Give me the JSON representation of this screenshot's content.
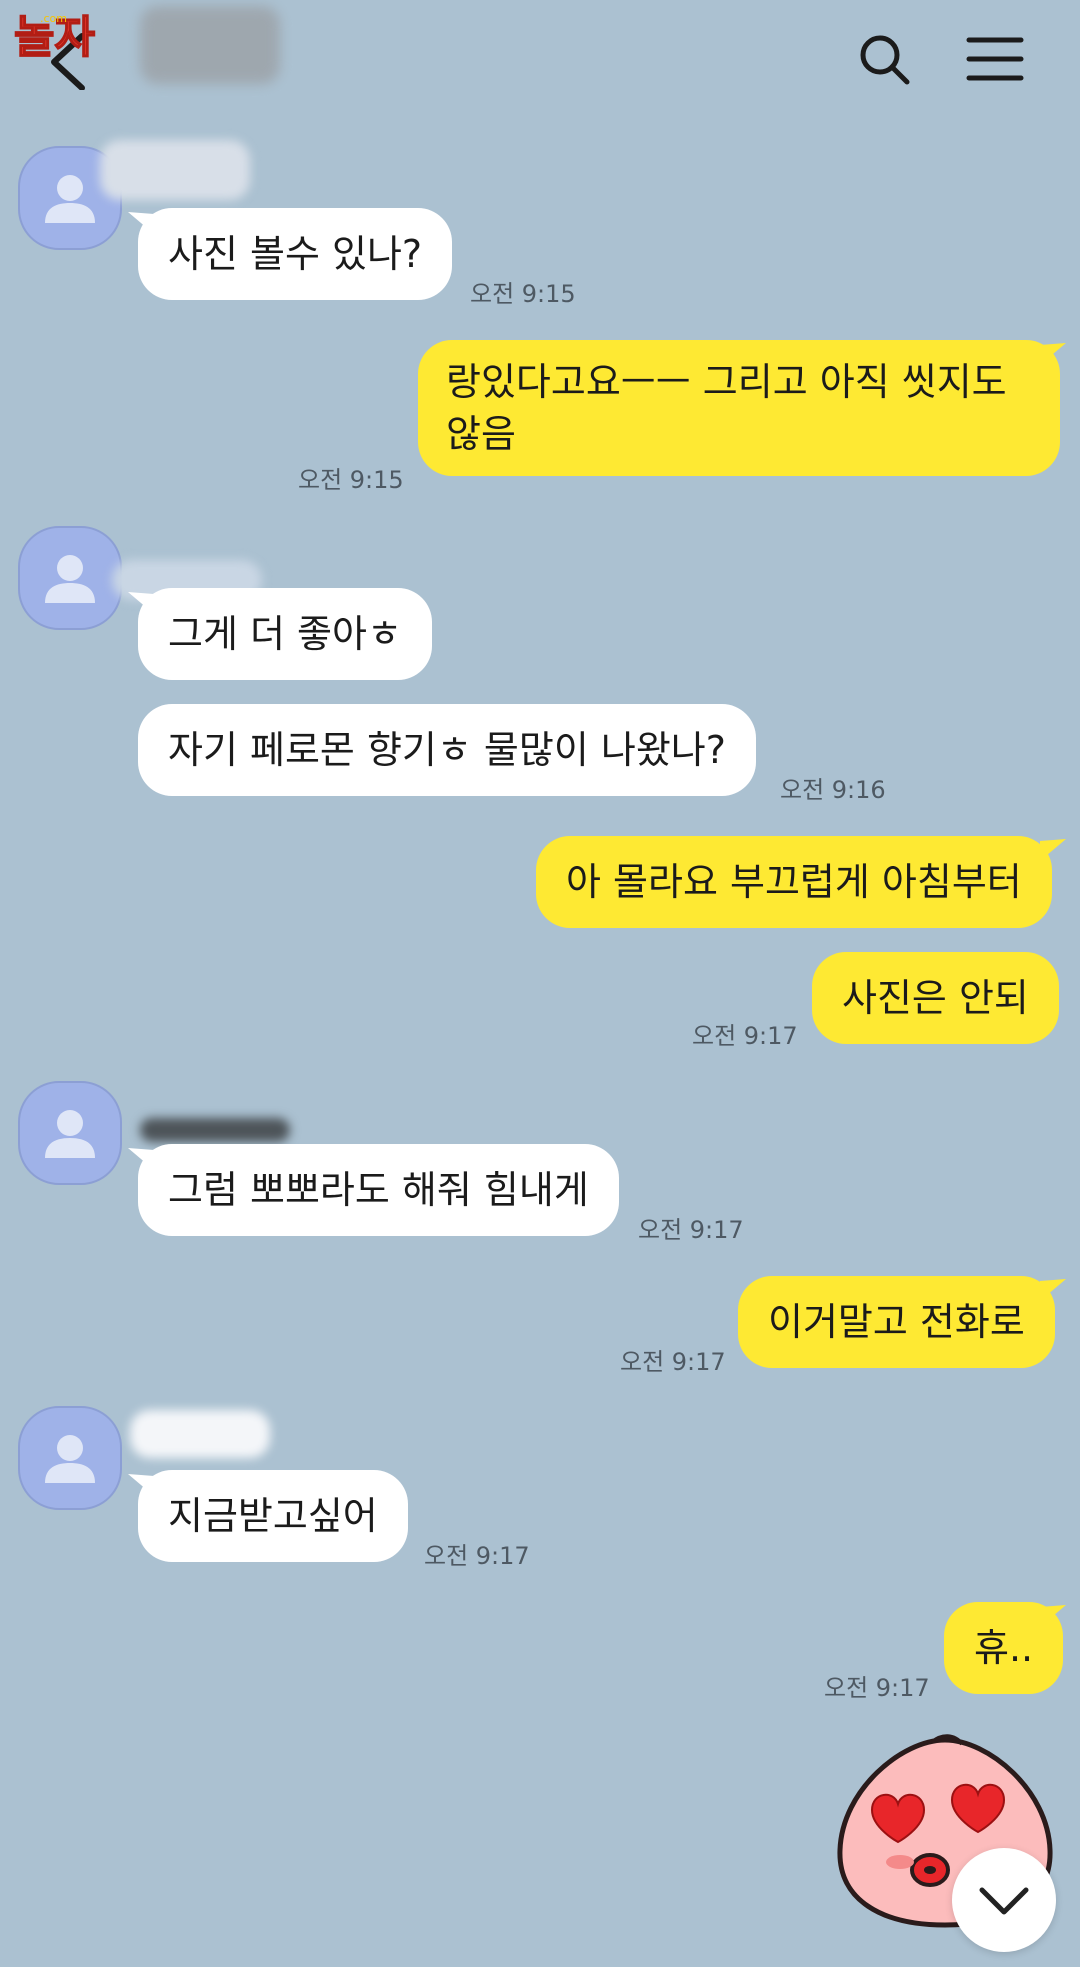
{
  "header": {
    "logo_text": "놀자",
    "logo_sub": ".com"
  },
  "messages": [
    {
      "id": "m1",
      "text": "사진 볼수 있나?",
      "time": "오전 9:15"
    },
    {
      "id": "m2",
      "text": "랑있다고요ㅡㅡ 그리고 아직 씻지도 않음",
      "time": "오전 9:15"
    },
    {
      "id": "m3",
      "text": "그게 더 좋아ㅎ"
    },
    {
      "id": "m4",
      "text": "자기 페로몬 향기ㅎ 물많이 나왔나?",
      "time": "오전 9:16"
    },
    {
      "id": "m5",
      "text": "아 몰라요 부끄럽게 아침부터"
    },
    {
      "id": "m6",
      "text": "사진은 안되",
      "time": "오전 9:17"
    },
    {
      "id": "m7",
      "text": "그럼 뽀뽀라도 해줘 힘내게",
      "time": "오전 9:17"
    },
    {
      "id": "m8",
      "text": "이거말고 전화로",
      "time": "오전 9:17"
    },
    {
      "id": "m9",
      "text": "지금받고싶어",
      "time": "오전 9:17"
    },
    {
      "id": "m10",
      "text": "휴..",
      "time": "오전 9:17"
    }
  ],
  "colors": {
    "background": "#abc1d1",
    "incoming_bubble": "#ffffff",
    "outgoing_bubble": "#fee933",
    "avatar": "#9fb2e8"
  },
  "icons": {
    "back": "back-arrow-icon",
    "search": "search-icon",
    "menu": "hamburger-menu-icon",
    "scroll": "chevron-down-icon",
    "avatar": "default-profile-icon",
    "emoticon": "peach-heart-eyes-emoticon"
  }
}
